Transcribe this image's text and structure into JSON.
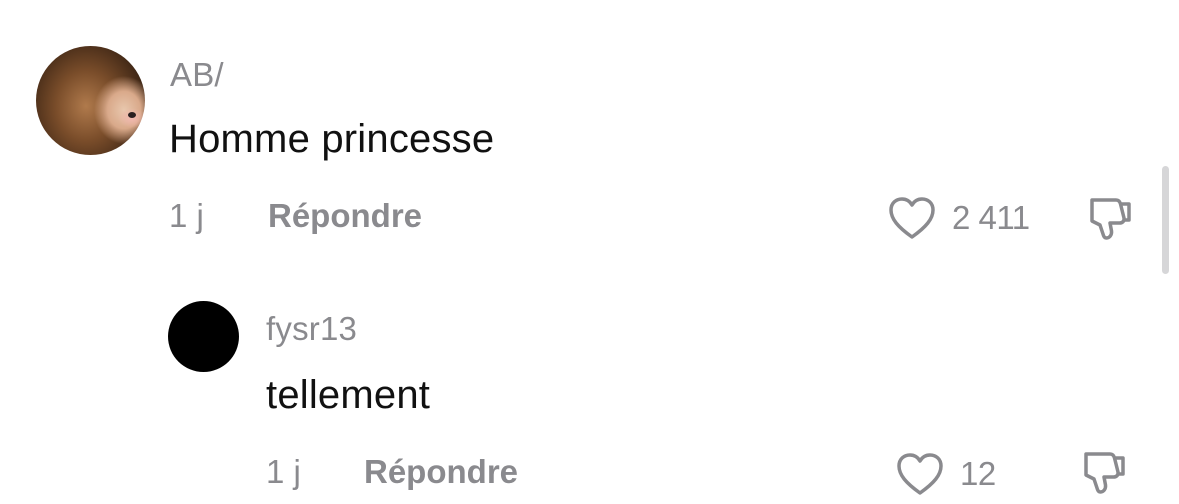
{
  "comments": [
    {
      "username": "AB/",
      "text": "Homme princesse",
      "time": "1 j",
      "reply_label": "Répondre",
      "likes": "2 411",
      "avatar": "photo-avatar"
    },
    {
      "username": "fysr13",
      "text": "tellement",
      "time": "1 j",
      "reply_label": "Répondre",
      "likes": "12",
      "avatar": "black-avatar"
    }
  ],
  "icons": {
    "like": "heart-outline-icon",
    "dislike": "thumbs-down-icon"
  },
  "colors": {
    "text_primary": "#111111",
    "text_secondary": "#8a8a8e",
    "background": "#ffffff"
  }
}
